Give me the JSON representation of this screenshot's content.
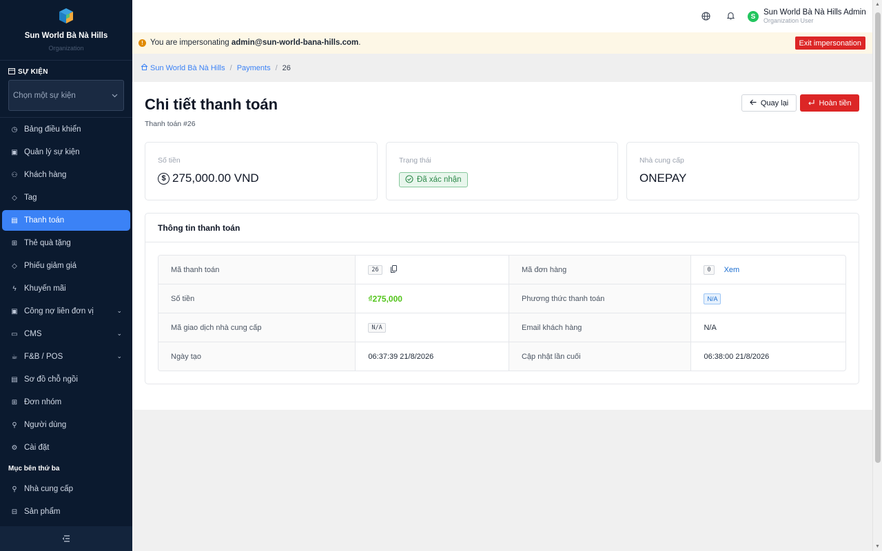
{
  "sidebar": {
    "brand_name": "Sun World Bà Nà Hills",
    "brand_sub": "Organization",
    "event_section_title": "SỰ KIỆN",
    "event_select_placeholder": "Chọn một sự kiện",
    "items": [
      {
        "label": "Bảng điều khiển",
        "icon": "dashboard-icon"
      },
      {
        "label": "Quản lý sự kiện",
        "icon": "calendar-icon"
      },
      {
        "label": "Khách hàng",
        "icon": "users-icon"
      },
      {
        "label": "Tag",
        "icon": "tag-icon"
      },
      {
        "label": "Thanh toán",
        "icon": "payment-icon",
        "active": true
      },
      {
        "label": "Thẻ quà tặng",
        "icon": "gift-icon"
      },
      {
        "label": "Phiếu giảm giá",
        "icon": "coupon-icon"
      },
      {
        "label": "Khuyến mãi",
        "icon": "promo-icon"
      },
      {
        "label": "Công nợ liên đơn vị",
        "icon": "debt-icon",
        "expandable": true
      },
      {
        "label": "CMS",
        "icon": "cms-icon",
        "expandable": true
      },
      {
        "label": "F&B / POS",
        "icon": "fnb-icon",
        "expandable": true
      },
      {
        "label": "Sơ đồ chỗ ngồi",
        "icon": "seatmap-icon"
      },
      {
        "label": "Đơn nhóm",
        "icon": "group-order-icon"
      },
      {
        "label": "Người dùng",
        "icon": "user-icon"
      },
      {
        "label": "Cài đặt",
        "icon": "settings-icon"
      }
    ],
    "third_party_title": "Mục bên thứ ba",
    "third_party_items": [
      {
        "label": "Nhà cung cấp",
        "icon": "provider-icon"
      },
      {
        "label": "Sản phẩm",
        "icon": "product-icon"
      }
    ]
  },
  "topbar": {
    "user_initial": "S",
    "user_name": "Sun World Bà Nà Hills Admin",
    "user_role": "Organization User"
  },
  "impersonation": {
    "prefix": "You are impersonating ",
    "email": "admin@sun-world-bana-hills.com",
    "suffix": ".",
    "exit_label": "Exit impersonation"
  },
  "breadcrumb": {
    "home": "Sun World Bà Nà Hills",
    "section": "Payments",
    "current": "26"
  },
  "page": {
    "title": "Chi tiết thanh toán",
    "subtitle": "Thanh toán #26",
    "back_label": "Quay lại",
    "refund_label": "Hoàn tiền"
  },
  "cards": {
    "amount_label": "Số tiền",
    "amount_value": "275,000.00 VND",
    "status_label": "Trạng thái",
    "status_value": "Đã xác nhận",
    "provider_label": "Nhà cung cấp",
    "provider_value": "ONEPAY"
  },
  "info": {
    "title": "Thông tin thanh toán",
    "payment_id_label": "Mã thanh toán",
    "payment_id": "26",
    "order_id_label": "Mã đơn hàng",
    "order_id": "0",
    "order_view": "Xem",
    "amount_label": "Số tiền",
    "amount": "₫275,000",
    "method_label": "Phương thức thanh toán",
    "method": "N/A",
    "provider_txn_label": "Mã giao dịch nhà cung cấp",
    "provider_txn": "N/A",
    "email_label": "Email khách hàng",
    "email": "N/A",
    "created_label": "Ngày tạo",
    "created": "06:37:39 21/8/2026",
    "updated_label": "Cập nhật lần cuối",
    "updated": "06:38:00 21/8/2026"
  },
  "colors": {
    "sidebar_bg": "#0b1a2f",
    "accent": "#3b82f6",
    "danger": "#dc2626",
    "success": "#52c41a"
  }
}
